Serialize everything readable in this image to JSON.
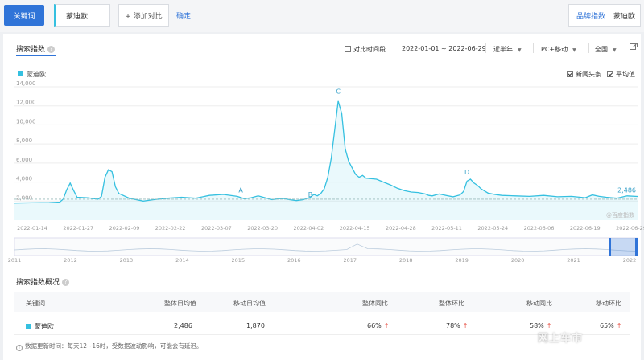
{
  "topbar": {
    "keyword_button": "关键词",
    "keyword_value": "蒙迪欧",
    "add_compare": "+ 添加对比",
    "confirm": "确定",
    "brand_label": "品牌指数",
    "brand_value": "蒙迪欧"
  },
  "panel": {
    "title": "搜索指数",
    "compare_period": "对比时间段",
    "date_range": "2022-01-01 ~ 2022-06-29",
    "period_select": "近半年",
    "device_select": "PC+移动",
    "region_select": "全国",
    "legend_label": "蒙迪欧",
    "opt_news": "新闻头条",
    "opt_avg": "平均值",
    "chart_watermark": "@百度指数"
  },
  "chart_data": {
    "type": "area",
    "series": [
      {
        "name": "蒙迪欧",
        "color": "#35c0e0",
        "start": "2022-01-01",
        "end": "2022-06-29",
        "points": [
          [
            0,
            1800
          ],
          [
            5,
            1820
          ],
          [
            10,
            1850
          ],
          [
            13,
            1900
          ],
          [
            14,
            2200
          ],
          [
            15,
            3200
          ],
          [
            16,
            3900
          ],
          [
            17,
            3100
          ],
          [
            18,
            2400
          ],
          [
            21,
            2350
          ],
          [
            24,
            2200
          ],
          [
            25,
            2500
          ],
          [
            26,
            4500
          ],
          [
            27,
            5300
          ],
          [
            28,
            5100
          ],
          [
            29,
            3500
          ],
          [
            30,
            2800
          ],
          [
            33,
            2300
          ],
          [
            37,
            2000
          ],
          [
            40,
            2150
          ],
          [
            44,
            2300
          ],
          [
            48,
            2400
          ],
          [
            52,
            2300
          ],
          [
            56,
            2600
          ],
          [
            60,
            2700
          ],
          [
            64,
            2500
          ],
          [
            66,
            2250
          ],
          [
            68,
            2350
          ],
          [
            70,
            2550
          ],
          [
            72,
            2350
          ],
          [
            74,
            2150
          ],
          [
            77,
            2300
          ],
          [
            79,
            2150
          ],
          [
            81,
            2050
          ],
          [
            83,
            2150
          ],
          [
            85,
            2400
          ],
          [
            86,
            2700
          ],
          [
            87,
            2550
          ],
          [
            88,
            2800
          ],
          [
            89,
            3300
          ],
          [
            90,
            4500
          ],
          [
            91,
            6500
          ],
          [
            92,
            9500
          ],
          [
            93,
            12500
          ],
          [
            94,
            11200
          ],
          [
            95,
            7500
          ],
          [
            96,
            6200
          ],
          [
            97,
            5500
          ],
          [
            98,
            4800
          ],
          [
            99,
            4500
          ],
          [
            100,
            4700
          ],
          [
            101,
            4400
          ],
          [
            104,
            4300
          ],
          [
            106,
            4000
          ],
          [
            108,
            3700
          ],
          [
            110,
            3350
          ],
          [
            112,
            3100
          ],
          [
            114,
            2950
          ],
          [
            116,
            2900
          ],
          [
            118,
            2750
          ],
          [
            119,
            2600
          ],
          [
            120,
            2550
          ],
          [
            122,
            2750
          ],
          [
            124,
            2600
          ],
          [
            126,
            2450
          ],
          [
            128,
            2650
          ],
          [
            129,
            3000
          ],
          [
            130,
            4100
          ],
          [
            131,
            4300
          ],
          [
            132,
            3900
          ],
          [
            133,
            3650
          ],
          [
            134,
            3300
          ],
          [
            136,
            2850
          ],
          [
            138,
            2700
          ],
          [
            140,
            2600
          ],
          [
            144,
            2550
          ],
          [
            148,
            2500
          ],
          [
            152,
            2600
          ],
          [
            156,
            2450
          ],
          [
            160,
            2500
          ],
          [
            164,
            2350
          ],
          [
            166,
            2650
          ],
          [
            168,
            2500
          ],
          [
            170,
            2400
          ],
          [
            173,
            2300
          ],
          [
            176,
            2550
          ],
          [
            179,
            2486
          ]
        ]
      }
    ],
    "yticks": [
      "2,000",
      "4,000",
      "6,000",
      "8,000",
      "10,000",
      "12,000",
      "14,000"
    ],
    "ymax": 14000,
    "xticks": [
      "2022-01-14",
      "2022-01-27",
      "2022-02-09",
      "2022-02-22",
      "2022-03-07",
      "2022-03-20",
      "2022-04-02",
      "2022-04-15",
      "2022-04-28",
      "2022-05-11",
      "2022-05-24",
      "2022-06-06",
      "2022-06-19",
      "2022-06-29"
    ],
    "average": 2200,
    "last_value_label": "2,486",
    "annotations": [
      {
        "label": "A",
        "day": 65,
        "value": 2900
      },
      {
        "label": "B",
        "day": 85,
        "value": 2450
      },
      {
        "label": "C",
        "day": 93,
        "value": 13300
      },
      {
        "label": "D",
        "day": 130,
        "value": 4800
      }
    ],
    "overview_years": [
      "2011",
      "2012",
      "2013",
      "2014",
      "2015",
      "2016",
      "2017",
      "2018",
      "2019",
      "2020",
      "2021",
      "2022"
    ]
  },
  "overview": {
    "title": "搜索指数概况",
    "headers": [
      "关键词",
      "整体日均值",
      "移动日均值",
      "整体同比",
      "整体环比",
      "移动同比",
      "移动环比"
    ],
    "row": {
      "keyword": "蒙迪欧",
      "overall_avg": "2,486",
      "mobile_avg": "1,870",
      "overall_yoy": "66%",
      "overall_mom": "78%",
      "mobile_yoy": "58%",
      "mobile_mom": "65%"
    },
    "note": "数据更新时间：每天12~16时，受数据波动影响，可能会有延迟。"
  },
  "watermark": "网上车市"
}
